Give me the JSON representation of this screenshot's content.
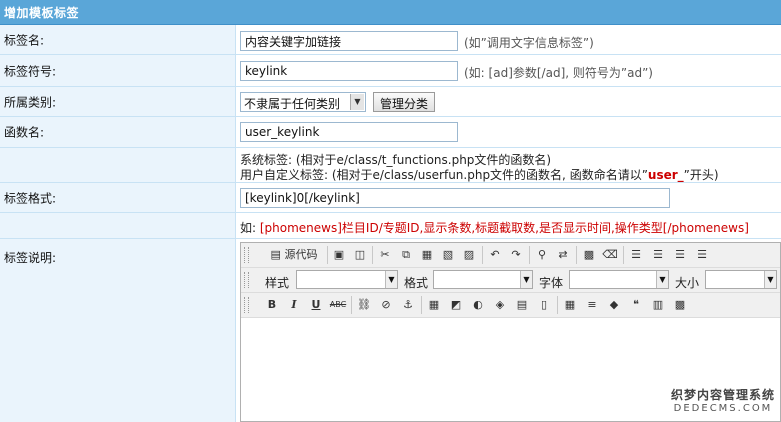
{
  "header": {
    "title": "增加模板标签"
  },
  "fields": {
    "tag_name": {
      "label": "标签名:",
      "value": "内容关键字加链接",
      "hint": "(如”调用文字信息标签”)"
    },
    "tag_symbol": {
      "label": "标签符号:",
      "value": "keylink",
      "hint": "(如: [ad]参数[/ad], 则符号为”ad”)"
    },
    "category": {
      "label": "所属类别:",
      "selected": "不隶属于任何类别",
      "manage_button": "管理分类"
    },
    "function_name": {
      "label": "函数名:",
      "value": "user_keylink"
    },
    "function_notes": {
      "line1": "系统标签: (相对于e/class/t_functions.php文件的函数名)",
      "line2_prefix": "用户自定义标签: (相对于e/class/userfun.php文件的函数名, 函数命名请以”",
      "line2_highlight": "user_",
      "line2_suffix": "”开头)"
    },
    "tag_format": {
      "label": "标签格式:",
      "value": "[keylink]0[/keylink]",
      "example_prefix": "如: ",
      "example": "[phomenews]栏目ID/专题ID,显示条数,标题截取数,是否显示时间,操作类型[/phomenews]"
    },
    "tag_description": {
      "label": "标签说明:"
    }
  },
  "editor": {
    "source_label": "源代码",
    "style_label": "样式",
    "format_label": "格式",
    "font_label": "字体",
    "size_label": "大小",
    "icons": {
      "row1": [
        "save-icon",
        "preview-icon",
        "cut-icon",
        "copy-icon",
        "paste-icon",
        "paste-text-icon",
        "paste-word-icon",
        "undo-icon",
        "redo-icon",
        "find-icon",
        "replace-icon",
        "select-all-icon",
        "remove-format-icon",
        "align-left-icon",
        "align-center-icon",
        "align-right-icon",
        "align-justify-icon"
      ],
      "row3": [
        "bold-icon",
        "italic-icon",
        "underline-icon",
        "strike-icon",
        "link-icon",
        "unlink-icon",
        "anchor-icon",
        "image-icon",
        "flash-icon",
        "media-icon",
        "page-break-icon",
        "file-icon",
        "table-icon",
        "horizontal-rule-icon",
        "special-char-icon",
        "blockquote-icon",
        "insert-row-icon",
        "paste-code-icon"
      ]
    }
  },
  "watermark": {
    "line1": "织梦内容管理系统",
    "line2": "DEDECMS.COM"
  }
}
